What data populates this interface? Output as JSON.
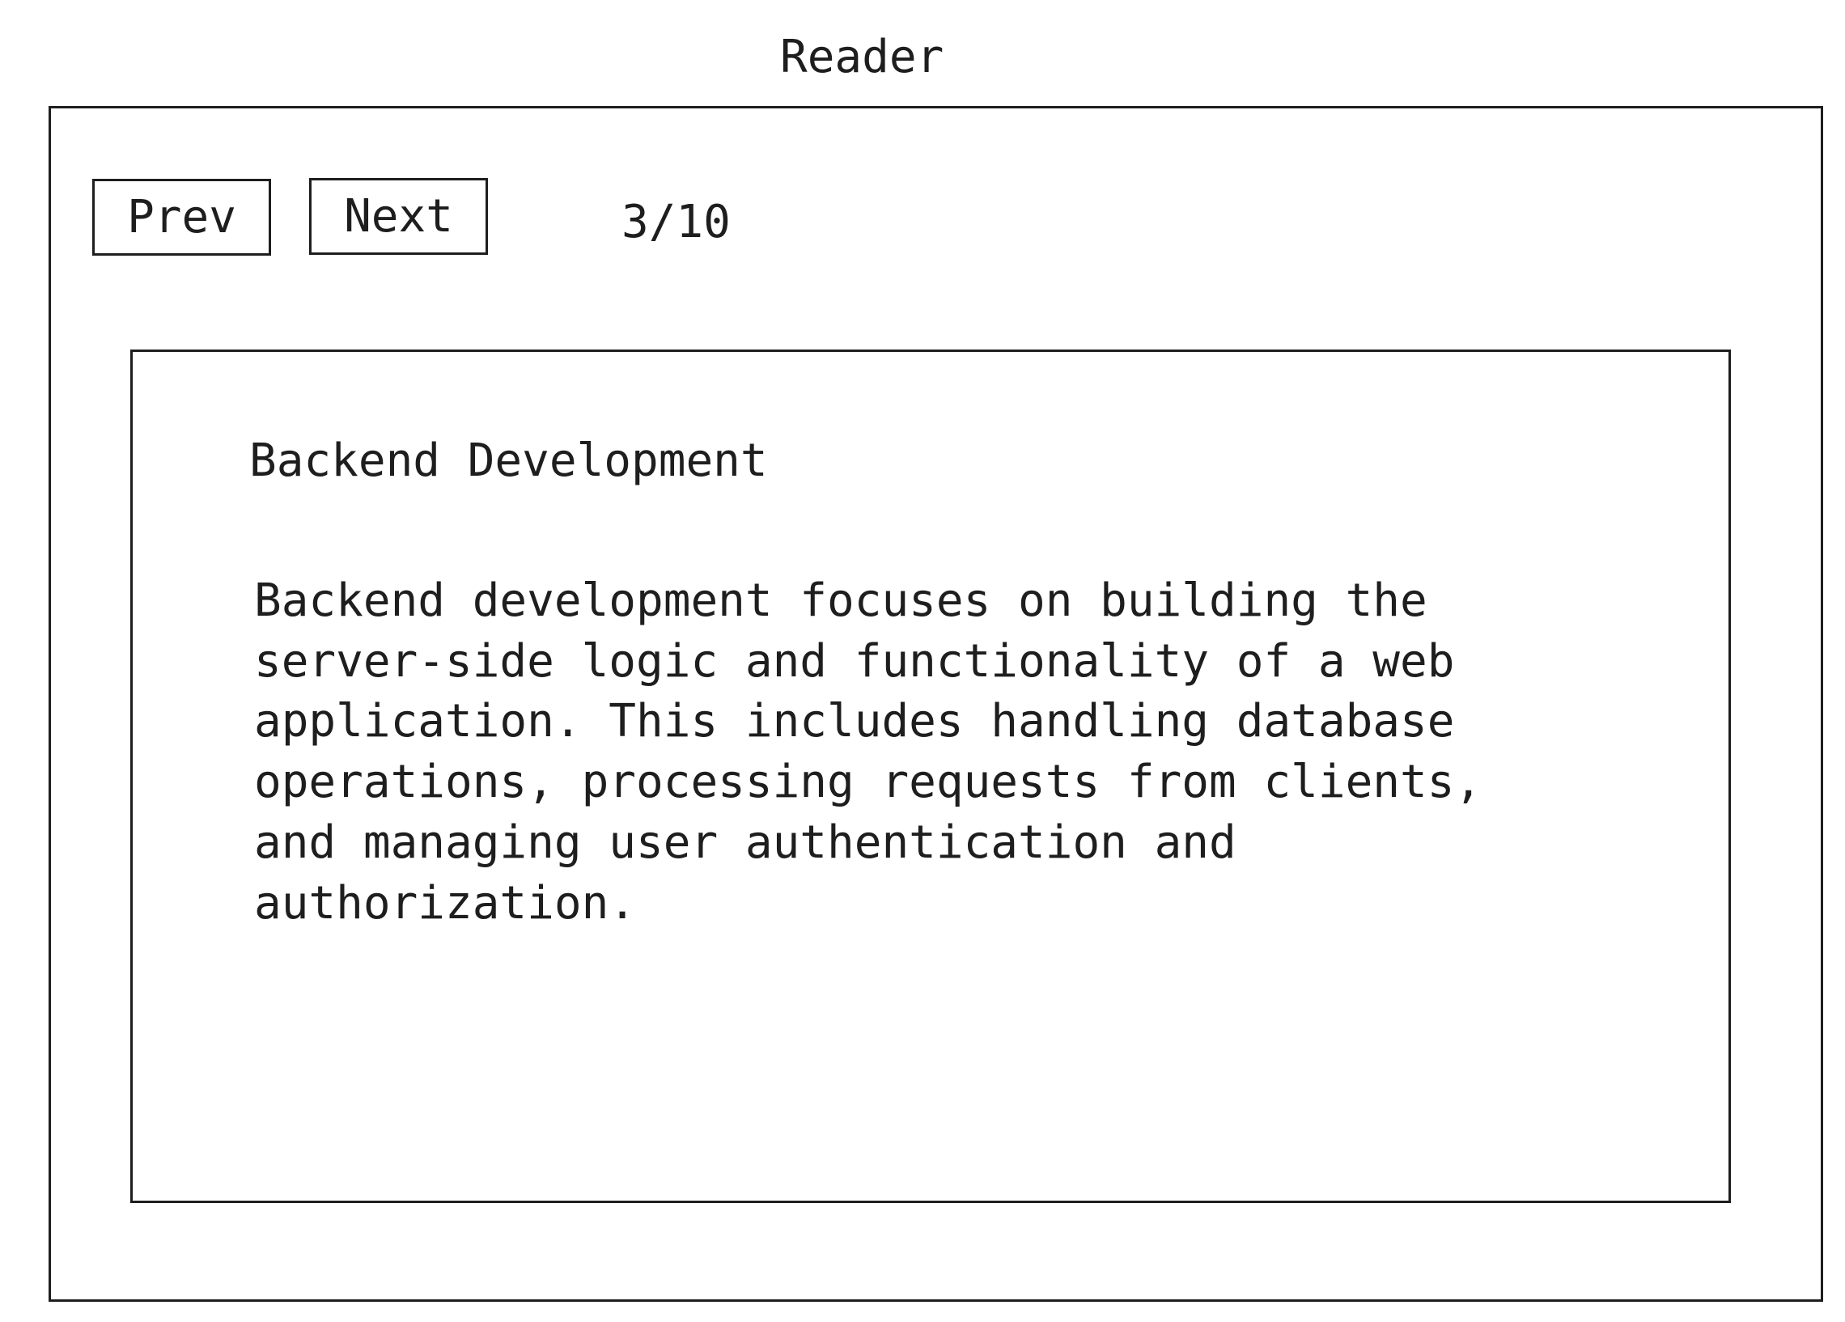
{
  "app": {
    "title": "Reader"
  },
  "toolbar": {
    "prev_label": "Prev",
    "next_label": "Next",
    "page_indicator": "3/10"
  },
  "article": {
    "title": "Backend Development",
    "body": "Backend development focuses on building the\nserver-side logic and functionality of a web\napplication. This includes handling database\noperations, processing requests from clients,\nand managing user authentication and\nauthorization."
  },
  "colors": {
    "ink": "#1e1e1e",
    "background": "#ffffff"
  }
}
